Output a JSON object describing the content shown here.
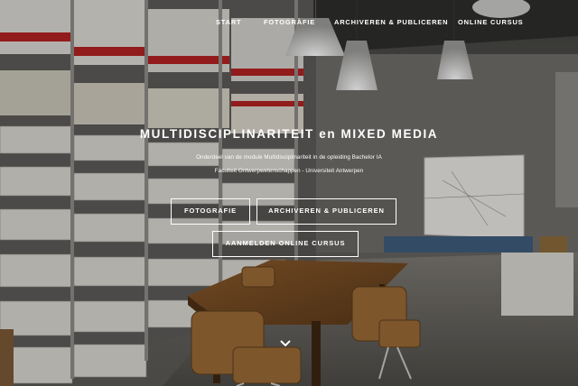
{
  "nav": {
    "items": [
      {
        "label": "START"
      },
      {
        "label": "FOTOGRAFIE"
      },
      {
        "label": "ARCHIVEREN & PUBLICEREN"
      },
      {
        "label": "ONLINE CURSUS"
      }
    ]
  },
  "hero": {
    "title": "MULTIDISCIPLINARITEIT en MIXED MEDIA",
    "subtitle_line1": "Onderdeel van de module Multidisciplinariteit in de opleiding Bachelor IA",
    "subtitle_line2": "Faculteit Ontwerpwetenschappen - Universiteit Antwerpen",
    "buttons": {
      "fotografie": "FOTOGRAFIE",
      "archiveren": "ARCHIVEREN & PUBLICEREN",
      "aanmelden": "AANMELDEN ONLINE CURSUS"
    },
    "scroll_icon": "chevron-down-icon"
  },
  "colors": {
    "text": "#ffffff",
    "button_border": "#ffffff"
  }
}
